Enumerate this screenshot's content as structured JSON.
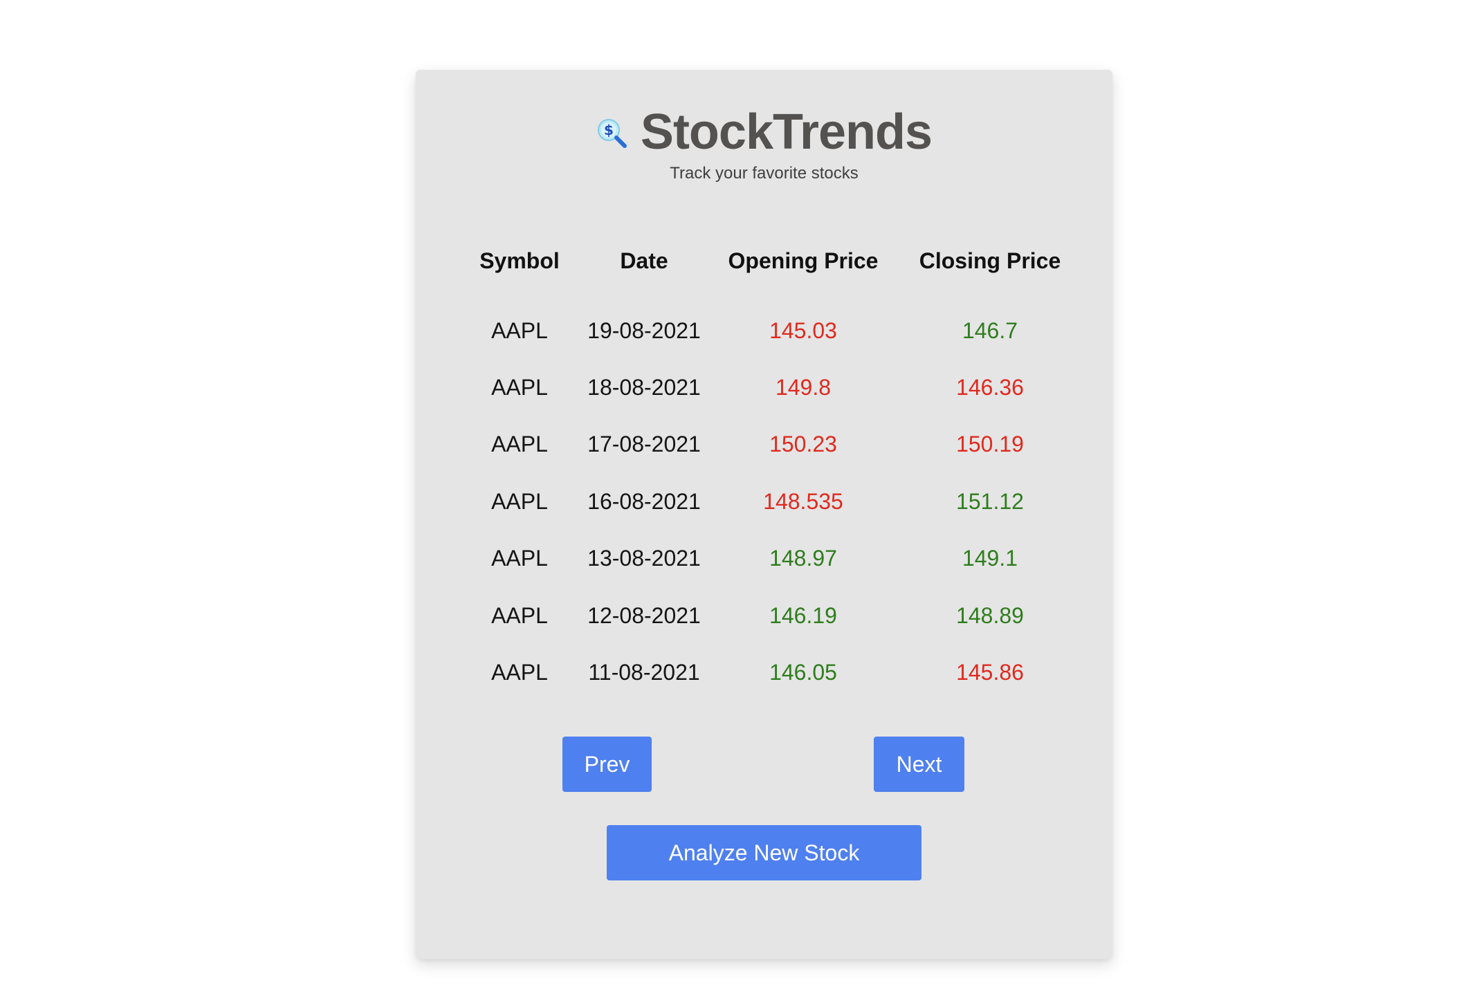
{
  "app": {
    "title": "StockTrends",
    "subtitle": "Track your favorite stocks",
    "logo_icon": "money-search-icon"
  },
  "colors": {
    "up": "#2e7d1c",
    "down": "#e0291e",
    "button": "#4f80ef",
    "card": "#e5e5e5",
    "title": "#545250"
  },
  "table": {
    "headers": [
      "Symbol",
      "Date",
      "Opening Price",
      "Closing Price"
    ],
    "rows": [
      {
        "symbol": "AAPL",
        "date": "19-08-2021",
        "open": "145.03",
        "open_trend": "down",
        "close": "146.7",
        "close_trend": "up"
      },
      {
        "symbol": "AAPL",
        "date": "18-08-2021",
        "open": "149.8",
        "open_trend": "down",
        "close": "146.36",
        "close_trend": "down"
      },
      {
        "symbol": "AAPL",
        "date": "17-08-2021",
        "open": "150.23",
        "open_trend": "down",
        "close": "150.19",
        "close_trend": "down"
      },
      {
        "symbol": "AAPL",
        "date": "16-08-2021",
        "open": "148.535",
        "open_trend": "down",
        "close": "151.12",
        "close_trend": "up"
      },
      {
        "symbol": "AAPL",
        "date": "13-08-2021",
        "open": "148.97",
        "open_trend": "up",
        "close": "149.1",
        "close_trend": "up"
      },
      {
        "symbol": "AAPL",
        "date": "12-08-2021",
        "open": "146.19",
        "open_trend": "up",
        "close": "148.89",
        "close_trend": "up"
      },
      {
        "symbol": "AAPL",
        "date": "11-08-2021",
        "open": "146.05",
        "open_trend": "up",
        "close": "145.86",
        "close_trend": "down"
      }
    ]
  },
  "pagination": {
    "prev_label": "Prev",
    "next_label": "Next"
  },
  "actions": {
    "analyze_label": "Analyze New Stock"
  }
}
